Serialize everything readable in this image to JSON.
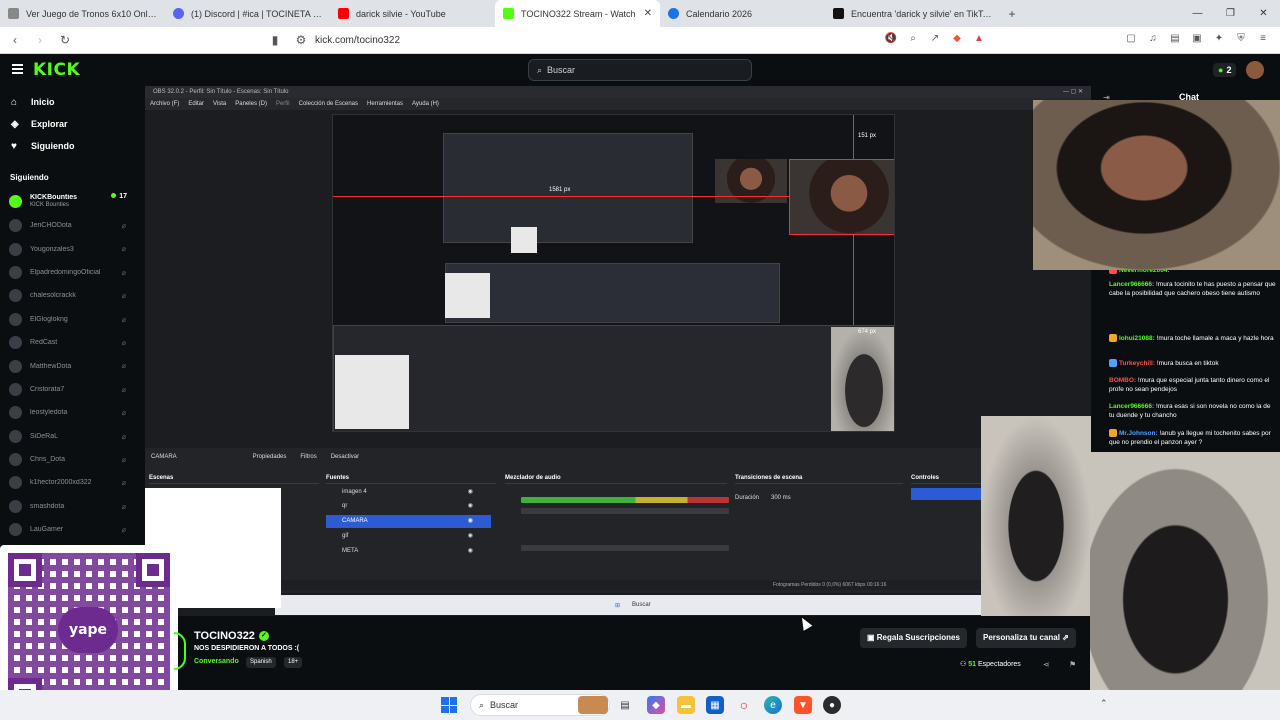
{
  "browser": {
    "tabs": [
      {
        "label": "Ver Juego de Tronos 6x10 Online Gra",
        "color": "#888888"
      },
      {
        "label": "(1) Discord | #ica | TOCINETA farm",
        "color": "#5865f2"
      },
      {
        "label": "darick silvie - YouTube",
        "color": "#ff0000"
      },
      {
        "label": "TOCINO322 Stream - Watch",
        "color": "#53fc18"
      },
      {
        "label": "Calendario 2026",
        "color": "#1a73e8"
      },
      {
        "label": "Encuentra 'darick y silvie' en TikTok |",
        "color": "#111111"
      }
    ],
    "url": "kick.com/tocino322"
  },
  "kick": {
    "logo": "KICK",
    "search_placeholder": "Buscar",
    "header_badge": "2",
    "nav": [
      {
        "label": "Inicio",
        "icon": "home-icon"
      },
      {
        "label": "Explorar",
        "icon": "compass-icon"
      },
      {
        "label": "Siguiendo",
        "icon": "heart-icon"
      }
    ],
    "following_title": "Siguiendo",
    "channels": [
      {
        "name": "KICKBounties",
        "sub": "KICK Bounties",
        "count": "17",
        "live": true
      },
      {
        "name": "JeriCHODota",
        "live": false
      },
      {
        "name": "Yougonzales3",
        "live": false
      },
      {
        "name": "ElpadredomingoOficial",
        "live": false
      },
      {
        "name": "chalesolcrackk",
        "live": false
      },
      {
        "name": "ElGloglokng",
        "live": false
      },
      {
        "name": "RedCast",
        "live": false
      },
      {
        "name": "MatthewDota",
        "live": false
      },
      {
        "name": "Cristorata7",
        "live": false
      },
      {
        "name": "leostyledota",
        "live": false
      },
      {
        "name": "SiDeRaL",
        "live": false
      },
      {
        "name": "Chris_Dota",
        "live": false
      },
      {
        "name": "k1hector2000xd322",
        "live": false
      },
      {
        "name": "smashdota",
        "live": false
      },
      {
        "name": "LauGamer",
        "live": false
      }
    ]
  },
  "obs": {
    "title": "OBS 32.0.2 - Perfil: Sin Título - Escenas: Sin Título",
    "menu": [
      "Archivo (F)",
      "Editar",
      "Vista",
      "Paneles (D)",
      "Perfil",
      "Colección de Escenas",
      "Herramientas",
      "Ayuda (H)"
    ],
    "preview_labels": [
      "151 px",
      "1581 px",
      "674 px"
    ],
    "dock_tabs": [
      "CAMARA",
      "Propiedades",
      "Filtros",
      "Desactivar"
    ],
    "headers": {
      "scenes": "Escenas",
      "sources": "Fuentes",
      "mixer": "Mezclador de audio",
      "transitions": "Transiciones de escena",
      "controls": "Controles"
    },
    "sources": [
      "imagen 4",
      "qr",
      "CAMARA",
      "gif",
      "META"
    ],
    "transition_duration_label": "Duración",
    "transition_duration_value": "300 ms",
    "status": "Fotogramas Perdidos 0 (0,0%)   6067 kbps   00:16:16",
    "taskbar_search": "Buscar"
  },
  "chat": {
    "title": "Chat",
    "messages": [
      {
        "user": "Nevermore2004:",
        "text": "",
        "color": "#53fc18"
      },
      {
        "user": "Lancer966666:",
        "text": "!mura tocinito te has puesto a pensar que cabe la posibilidad que cachero obeso tiene autismo",
        "color": "#53fc18"
      },
      {
        "user": "lohui21088:",
        "text": "!mura toche llamale a maca y hazle hora",
        "color": "#53fc18"
      },
      {
        "user": "Turkeychill:",
        "text": "!mura busca en tiktok",
        "color": "#ff4d4d"
      },
      {
        "user": "BOMBO:",
        "text": "!mura que especial junta tanto dinero como el profe no sean pendejos",
        "color": "#ff4d4d"
      },
      {
        "user": "Lancer966666:",
        "text": "!mura esas si son novela no como la de tu duende y tu chancho",
        "color": "#53fc18"
      },
      {
        "user": "Mr.Johnson:",
        "text": "!anub ya llegue mi tochenito sabes por que no prendio el panzon ayer ?",
        "color": "#4da3ff"
      }
    ]
  },
  "channel": {
    "name": "TOCINO322",
    "title": "NOS DESPIDIERON A TODOS :(",
    "category": "Conversando",
    "tags": [
      "Spanish",
      "18+"
    ],
    "gift_button": "Regala Suscripciones",
    "customize_button": "Personaliza tu canal",
    "viewers_count": "51",
    "viewers_label": "Espectadores"
  },
  "qr": {
    "logo_text": "yape"
  },
  "taskbar": {
    "search": "Buscar"
  }
}
